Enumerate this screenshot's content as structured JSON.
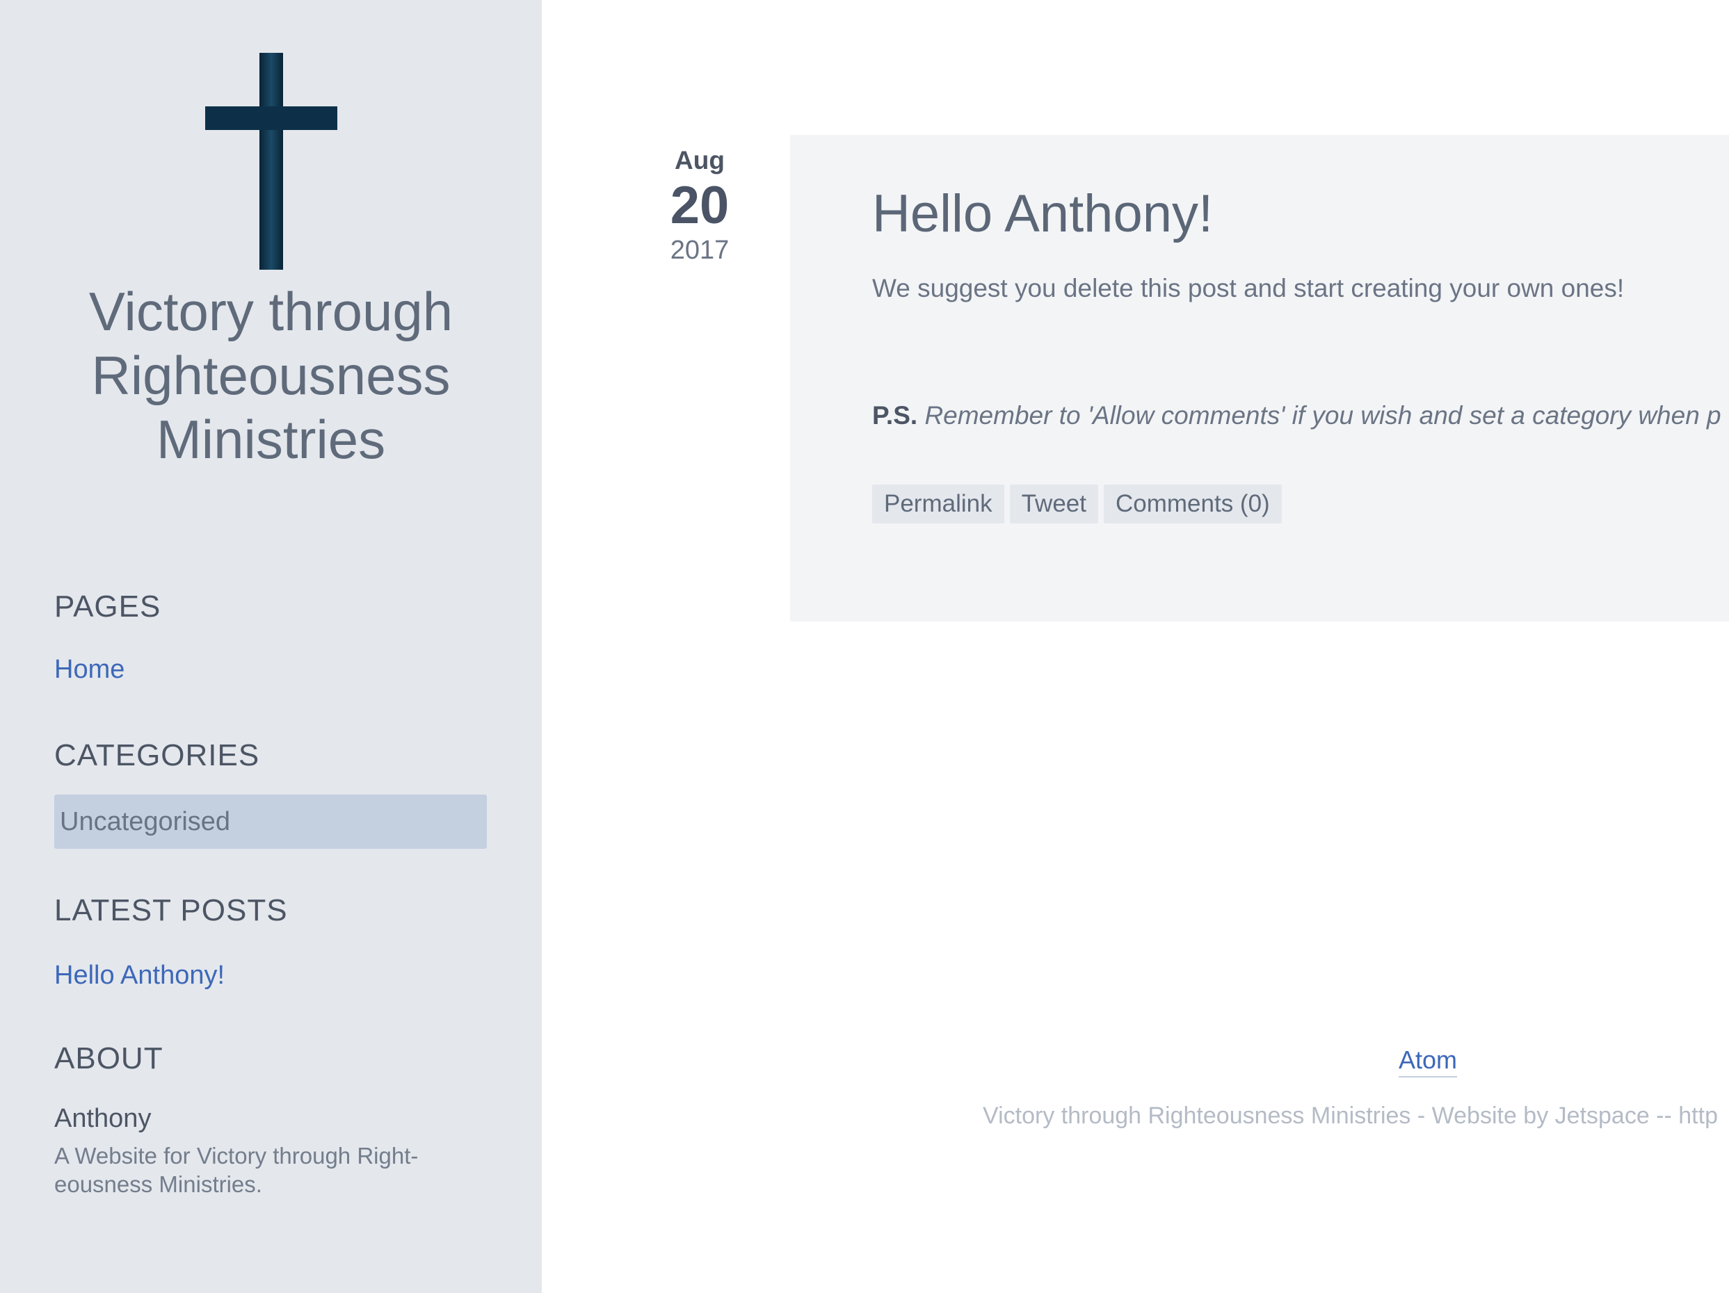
{
  "sidebar": {
    "site_title_line1": "Victory through",
    "site_title_line2": "Righteousness",
    "site_title_line3": "Ministries",
    "logo_icon": "cross-icon",
    "pages": {
      "title": "PAGES",
      "items": [
        "Home"
      ]
    },
    "categories": {
      "title": "CATEGORIES",
      "items": [
        "Uncategorised"
      ]
    },
    "latest_posts": {
      "title": "LATEST POSTS",
      "items": [
        "Hello Anthony!"
      ]
    },
    "about": {
      "title": "ABOUT",
      "name": "Anthony",
      "description_line1": "A Website for Victory through Right-",
      "description_line2": "eousness Ministries."
    }
  },
  "post": {
    "date": {
      "month": "Aug",
      "day": "20",
      "year": "2017"
    },
    "title": "Hello Anthony!",
    "body": "We suggest you delete this post and start creating your own ones!",
    "ps_label": "P.S.",
    "ps_text": "Remember to 'Allow comments' if you wish and set a category when p",
    "actions": {
      "permalink": "Permalink",
      "tweet": "Tweet",
      "comments": "Comments (0)"
    }
  },
  "footer": {
    "atom_link": "Atom",
    "credit": "Victory through Righteousness Ministries - Website by Jetspace -- http"
  },
  "colors": {
    "sidebar_bg": "#e4e7ec",
    "link": "#3d68b8",
    "cross": "#0d3048",
    "card_bg": "#f3f4f6"
  }
}
